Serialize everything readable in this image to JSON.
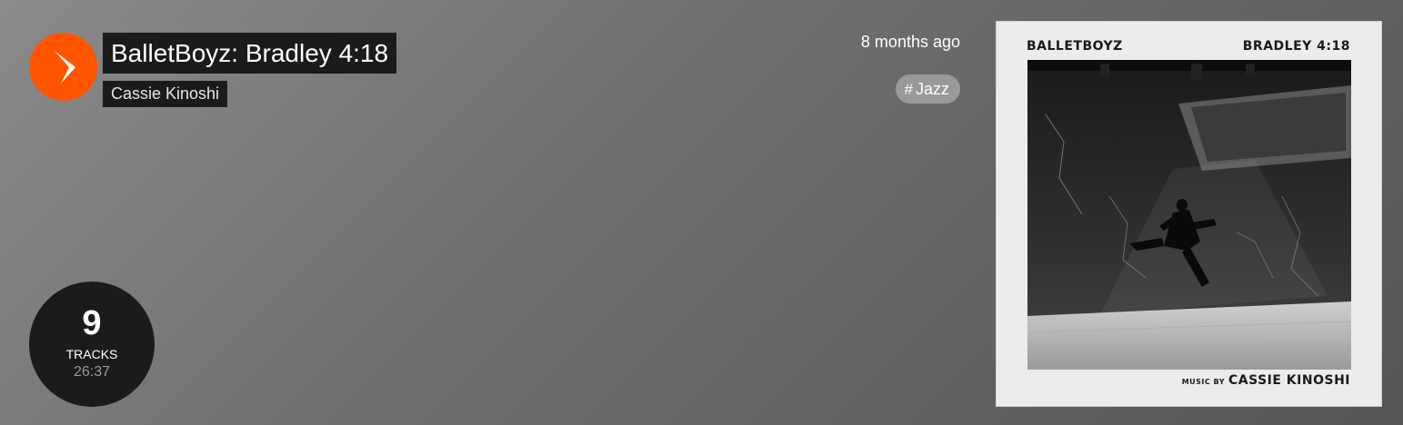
{
  "playlist": {
    "title": "BalletBoyz: Bradley 4:18",
    "artist": "Cassie Kinoshi",
    "posted": "8 months ago",
    "tag": "Jazz",
    "track_count": "9",
    "tracks_label": "TRACKS",
    "duration": "26:37"
  },
  "artwork": {
    "top_left": "BALLETBOYZ",
    "top_right": "BRADLEY 4:18",
    "music_by": "MUSIC BY",
    "composer": "CASSIE  KINOSHI"
  },
  "icons": {
    "play": "play-icon",
    "tag": "hash-icon"
  },
  "colors": {
    "accent": "#ff5500",
    "label_bg": "#1b1b1b",
    "tag_bg": "#999999"
  }
}
